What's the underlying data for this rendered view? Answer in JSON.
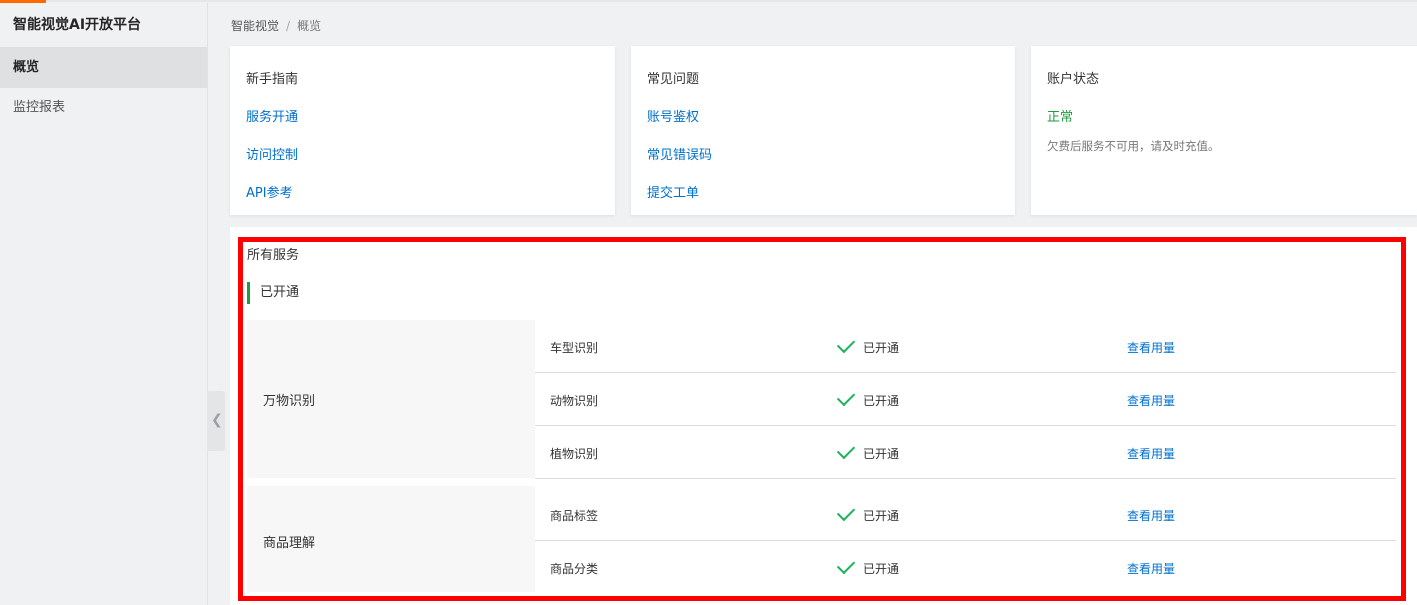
{
  "sidebar": {
    "brand": "智能视觉AI开放平台",
    "items": [
      {
        "label": "概览",
        "active": true
      },
      {
        "label": "监控报表",
        "active": false
      }
    ]
  },
  "breadcrumb": {
    "parent": "智能视觉",
    "separator": "/",
    "current": "概览"
  },
  "cards": {
    "guide": {
      "title": "新手指南",
      "links": [
        "服务开通",
        "访问控制",
        "API参考"
      ]
    },
    "faq": {
      "title": "常见问题",
      "links": [
        "账号鉴权",
        "常见错误码",
        "提交工单"
      ]
    },
    "account": {
      "title": "账户状态",
      "status": "正常",
      "note": "欠费后服务不可用，请及时充值。"
    }
  },
  "services": {
    "title": "所有服务",
    "section": "已开通",
    "categories": [
      {
        "name": "万物识别",
        "items": [
          {
            "name": "车型识别",
            "status": "已开通",
            "action": "查看用量"
          },
          {
            "name": "动物识别",
            "status": "已开通",
            "action": "查看用量"
          },
          {
            "name": "植物识别",
            "status": "已开通",
            "action": "查看用量"
          }
        ]
      },
      {
        "name": "商品理解",
        "items": [
          {
            "name": "商品标签",
            "status": "已开通",
            "action": "查看用量"
          },
          {
            "name": "商品分类",
            "status": "已开通",
            "action": "查看用量"
          }
        ]
      }
    ]
  },
  "colors": {
    "accent": "#ff6a00",
    "link": "#0070cc",
    "success": "#1f9a3d",
    "highlight": "#ff0000"
  }
}
